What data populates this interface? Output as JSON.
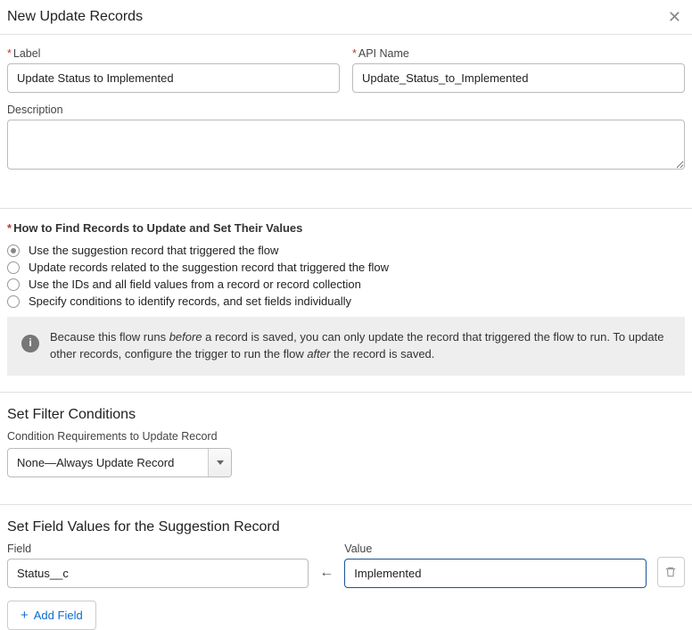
{
  "header": {
    "title": "New Update Records"
  },
  "fields": {
    "label_label": "Label",
    "label_value": "Update Status to Implemented",
    "api_label": "API Name",
    "api_value": "Update_Status_to_Implemented",
    "desc_label": "Description",
    "desc_value": ""
  },
  "howToFind": {
    "heading": "How to Find Records to Update and Set Their Values",
    "options": [
      "Use the suggestion record that triggered the flow",
      "Update records related to the suggestion record that triggered the flow",
      "Use the IDs and all field values from a record or record collection",
      "Specify conditions to identify records, and set fields individually"
    ],
    "selectedIndex": 0
  },
  "info": {
    "pre": "Because this flow runs ",
    "em1": "before",
    "mid": " a record is saved, you can only update the record that triggered the flow to run. To update other records, configure the trigger to run the flow ",
    "em2": "after",
    "post": " the record is saved."
  },
  "filter": {
    "title": "Set Filter Conditions",
    "sublabel": "Condition Requirements to Update Record",
    "selected": "None—Always Update Record"
  },
  "fieldValues": {
    "title": "Set Field Values for the Suggestion Record",
    "field_label": "Field",
    "value_label": "Value",
    "rows": [
      {
        "field": "Status__c",
        "value": "Implemented"
      }
    ],
    "add_label": "Add Field"
  }
}
